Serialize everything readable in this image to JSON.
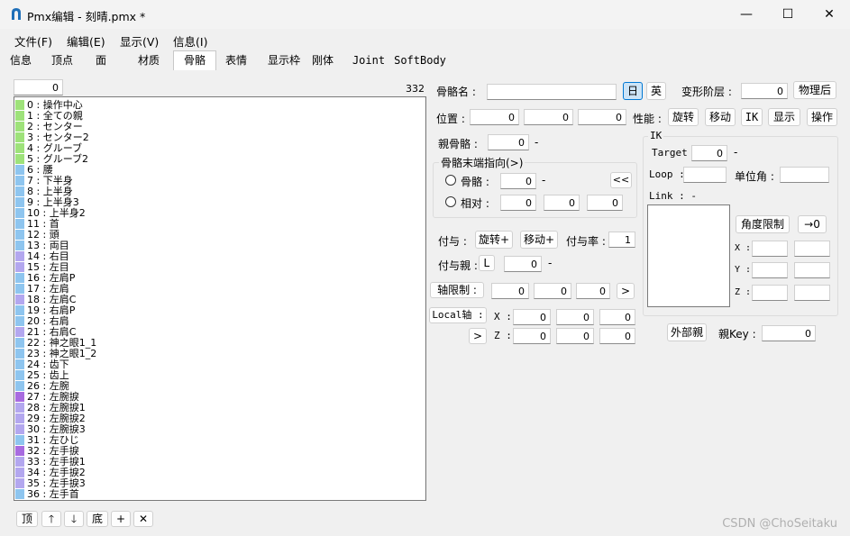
{
  "window": {
    "title": "Pmx编辑 - 刻晴.pmx *",
    "minimize": "—",
    "maximize": "☐",
    "close": "✕"
  },
  "menu": [
    "文件(F)",
    "编辑(E)",
    "显示(V)",
    "信息(I)"
  ],
  "tabs": [
    "信息",
    "顶点",
    "面",
    "材质",
    "骨骼",
    "表情",
    "显示枠",
    "刚体",
    "Joint",
    "SoftBody"
  ],
  "active_tab": "骨骼",
  "list": {
    "header_index": "0",
    "count": "332",
    "rows": [
      {
        "text": "0 : 操作中心",
        "color": "#9ee27a"
      },
      {
        "text": "1 : 全ての親",
        "color": "#9ee27a"
      },
      {
        "text": "2 : センター",
        "color": "#9ee27a"
      },
      {
        "text": "3 : センター2",
        "color": "#9ee27a"
      },
      {
        "text": "4 : グルーブ",
        "color": "#9ee27a"
      },
      {
        "text": "5 : グルーブ2",
        "color": "#9ee27a"
      },
      {
        "text": "6 : 腰",
        "color": "#8ec5ef"
      },
      {
        "text": "7 : 下半身",
        "color": "#8ec5ef"
      },
      {
        "text": "8 : 上半身",
        "color": "#8ec5ef"
      },
      {
        "text": "9 : 上半身3",
        "color": "#8ec5ef"
      },
      {
        "text": "10 : 上半身2",
        "color": "#8ec5ef"
      },
      {
        "text": "11 : 首",
        "color": "#8ec5ef"
      },
      {
        "text": "12 : 頭",
        "color": "#8ec5ef"
      },
      {
        "text": "13 : 両目",
        "color": "#8ec5ef"
      },
      {
        "text": "14 : 右目",
        "color": "#b3a7ef"
      },
      {
        "text": "15 : 左目",
        "color": "#b3a7ef"
      },
      {
        "text": "16 : 左肩P",
        "color": "#8ec5ef"
      },
      {
        "text": "17 : 左肩",
        "color": "#8ec5ef"
      },
      {
        "text": "18 : 左肩C",
        "color": "#b3a7ef"
      },
      {
        "text": "19 : 右肩P",
        "color": "#8ec5ef"
      },
      {
        "text": "20 : 右肩",
        "color": "#8ec5ef"
      },
      {
        "text": "21 : 右肩C",
        "color": "#b3a7ef"
      },
      {
        "text": "22 : 神之眼1_1",
        "color": "#8ec5ef"
      },
      {
        "text": "23 : 神之眼1_2",
        "color": "#8ec5ef"
      },
      {
        "text": "24 : 齿下",
        "color": "#8ec5ef"
      },
      {
        "text": "25 : 齿上",
        "color": "#8ec5ef"
      },
      {
        "text": "26 : 左腕",
        "color": "#8ec5ef"
      },
      {
        "text": "27 : 左腕捩",
        "color": "#a86be0"
      },
      {
        "text": "28 : 左腕捩1",
        "color": "#b3a7ef"
      },
      {
        "text": "29 : 左腕捩2",
        "color": "#b3a7ef"
      },
      {
        "text": "30 : 左腕捩3",
        "color": "#b3a7ef"
      },
      {
        "text": "31 : 左ひじ",
        "color": "#8ec5ef"
      },
      {
        "text": "32 : 左手捩",
        "color": "#a86be0"
      },
      {
        "text": "33 : 左手捩1",
        "color": "#b3a7ef"
      },
      {
        "text": "34 : 左手捩2",
        "color": "#b3a7ef"
      },
      {
        "text": "35 : 左手捩3",
        "color": "#b3a7ef"
      },
      {
        "text": "36 : 左手首",
        "color": "#8ec5ef"
      }
    ]
  },
  "list_buttons": {
    "top": "顶",
    "up": "🡑",
    "down": "🡓",
    "bottom": "底",
    "add": "+",
    "delete": "✕"
  },
  "props": {
    "bone_name_label": "骨骼名 :",
    "bone_name": "",
    "lang_jp": "日",
    "lang_en": "英",
    "deform_label": "变形阶层 :",
    "deform_value": "0",
    "after_physics": "物理后",
    "position_label": "位置 :",
    "position": [
      "0",
      "0",
      "0"
    ],
    "perf_label": "性能 :",
    "perf_buttons": [
      "旋转",
      "移动",
      "IK",
      "显示",
      "操作"
    ],
    "parent_label": "親骨骼 :",
    "parent_value": "0",
    "parent_dash": "-",
    "tail_group": "骨骼末端指向(>)",
    "tail_bone_label": "骨骼 :",
    "tail_bone_value": "0",
    "tail_bone_dash": "-",
    "tail_rel_label": "相对 :",
    "tail_rel": [
      "0",
      "0",
      "0"
    ],
    "tail_button": "<<",
    "grant_label": "付与 :",
    "grant_rotate": "旋转+",
    "grant_move": "移动+",
    "grant_rate_label": "付与率 :",
    "grant_rate": "1",
    "grant_parent_label": "付与親 :",
    "grant_L": "L",
    "grant_parent_value": "0",
    "grant_parent_dash": "-",
    "axis_limit_label": "轴限制 :",
    "axis_limit": [
      "0",
      "0",
      "0"
    ],
    "axis_arrow": ">",
    "local_axis_label": "Local轴 :",
    "local_x_label": "X :",
    "local_z_label": "Z :",
    "local_x": [
      "0",
      "0",
      "0"
    ],
    "local_z": [
      "0",
      "0",
      "0"
    ],
    "local_arrow": ">",
    "ik_title": "IK",
    "ik_target_label": "Target :",
    "ik_target_value": "0",
    "ik_target_dash": "-",
    "ik_loop_label": "Loop :",
    "ik_loop": "",
    "ik_unit_angle_label": "单位角 :",
    "ik_unit_angle": "",
    "ik_link_label": "Link : -",
    "ik_angle_limit": "角度限制",
    "ik_to_zero": "→0",
    "ik_x_label": "X :",
    "ik_y_label": "Y :",
    "ik_z_label": "Z :",
    "external_parent": "外部親",
    "parent_key_label": "親Key :",
    "parent_key": "0"
  },
  "watermark": "CSDN @ChoSeitaku"
}
